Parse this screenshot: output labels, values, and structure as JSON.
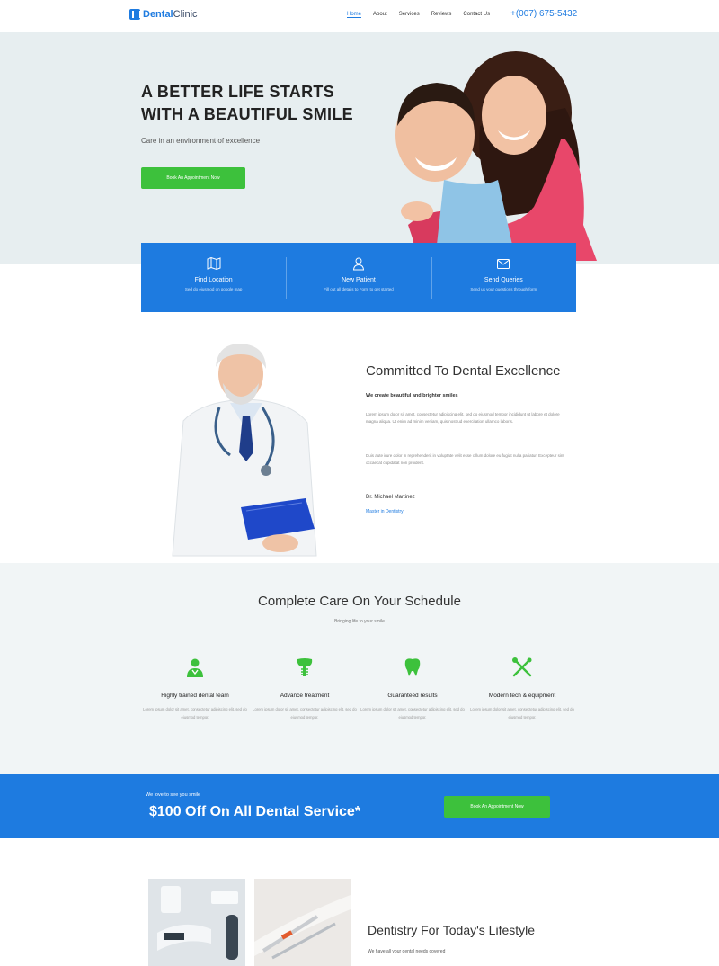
{
  "nav": {
    "logo_bold": "Dental",
    "logo_light": "Clinic",
    "links": [
      "Home",
      "About",
      "Services",
      "Reviews",
      "Contact Us"
    ],
    "phone": "+(007) 675-5432"
  },
  "hero": {
    "title_line1": "A BETTER LIFE STARTS",
    "title_line2": "WITH A BEAUTIFUL SMILE",
    "subtitle": "Care in an environment of excellence",
    "button": "Book An Appointment Now"
  },
  "infobar": {
    "items": [
      {
        "icon": "map-icon",
        "title": "Find Location",
        "desc": "Sed do eiusmod on google map"
      },
      {
        "icon": "user-icon",
        "title": "New Patient",
        "desc": "Fill out all details to Form to get started"
      },
      {
        "icon": "mail-icon",
        "title": "Send Queries",
        "desc": "Send us your questions through form"
      }
    ]
  },
  "about": {
    "title": "Committed To Dental Excellence",
    "lead": "We create beautiful and brighter smiles",
    "p1": "Lorem ipsum dolor sit amet, consectetur adipiscing elit, sed do eiusmod tempor incididunt ut labore et dolore magna aliqua. Ut enim ad minim veniam, quis nostrud exercitation ullamco laboris.",
    "p2": "Duis aute irure dolor in reprehenderit in voluptate velit esse cillum dolore eu fugiat nulla pariatur. Excepteur sint occaecat cupidatat non proident.",
    "name": "Dr. Michael Martinez",
    "role": "Master in Dentistry"
  },
  "care": {
    "title": "Complete Care On Your Schedule",
    "subtitle": "Bringing life to your smile",
    "features": [
      {
        "icon": "doctor-icon",
        "title": "Highly trained dental team",
        "desc": "Lorem ipsum dolor sit amet, consectetur adipiscing elit, sed do eiusmod tempor."
      },
      {
        "icon": "tooth-implant-icon",
        "title": "Advance treatment",
        "desc": "Lorem ipsum dolor sit amet, consectetur adipiscing elit, sed do eiusmod tempor."
      },
      {
        "icon": "tooth-icon",
        "title": "Guaranteed results",
        "desc": "Lorem ipsum dolor sit amet, consectetur adipiscing elit, sed do eiusmod tempor."
      },
      {
        "icon": "dental-tools-icon",
        "title": "Modern tech & equipment",
        "desc": "Lorem ipsum dolor sit amet, consectetur adipiscing elit, sed do eiusmod tempor."
      }
    ]
  },
  "promo": {
    "kicker": "We love to see you smile",
    "title": "$100 Off On All Dental Service*",
    "button": "Book An Appointment Now"
  },
  "lifestyle": {
    "title": "Dentistry For Today's Lifestyle",
    "subtitle": "We have all your dental needs covered"
  },
  "colors": {
    "brand": "#1e7be0",
    "accent": "#3dc13c",
    "hero_bg": "#e7eef0",
    "section_bg": "#f1f5f6"
  }
}
